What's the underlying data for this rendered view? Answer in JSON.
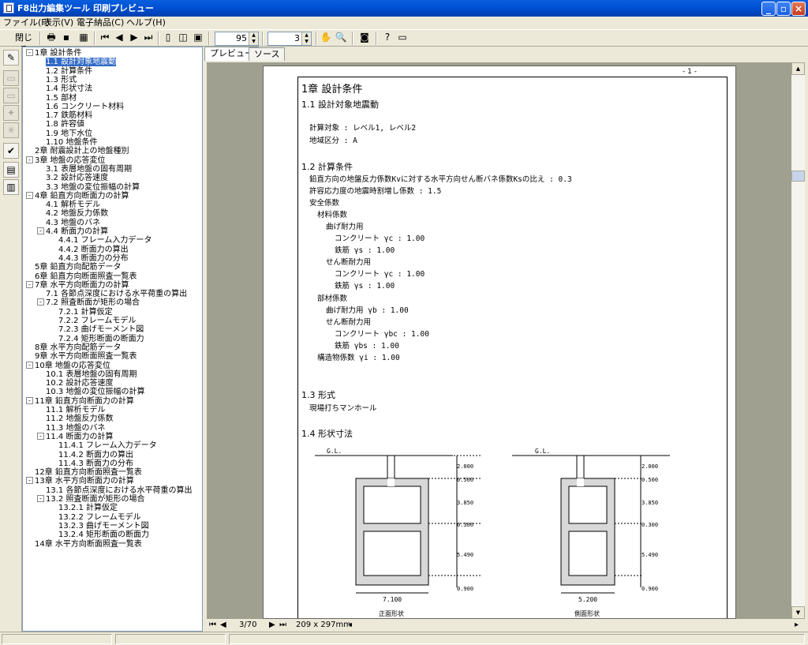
{
  "window": {
    "title": "F8出力編集ツール 印刷プレビュー"
  },
  "menu": [
    "ファイル(F)",
    "表示(V)",
    "電子納品(C)",
    "ヘルプ(H)"
  ],
  "toolbar": {
    "close_label": "閉じる",
    "zoom_value": "95",
    "page_value": "3"
  },
  "tabs": [
    "プレビュー",
    "ソース"
  ],
  "tree": [
    {
      "label": "1章 設計条件",
      "level": 0,
      "toggle": "-"
    },
    {
      "label": "1.1 設計対象地震動",
      "level": 1,
      "selected": true
    },
    {
      "label": "1.2 計算条件",
      "level": 1
    },
    {
      "label": "1.3 形式",
      "level": 1
    },
    {
      "label": "1.4 形状寸法",
      "level": 1
    },
    {
      "label": "1.5 部材",
      "level": 1
    },
    {
      "label": "1.6 コンクリート材料",
      "level": 1
    },
    {
      "label": "1.7 鉄筋材料",
      "level": 1
    },
    {
      "label": "1.8 許容値",
      "level": 1
    },
    {
      "label": "1.9 地下水位",
      "level": 1
    },
    {
      "label": "1.10 地盤条件",
      "level": 1
    },
    {
      "label": "2章 耐震設計上の地盤種別",
      "level": 0
    },
    {
      "label": "3章 地盤の応答変位",
      "level": 0,
      "toggle": "-"
    },
    {
      "label": "3.1 表層地盤の固有周期",
      "level": 1
    },
    {
      "label": "3.2 設計応答速度",
      "level": 1
    },
    {
      "label": "3.3 地盤の変位振幅の計算",
      "level": 1
    },
    {
      "label": "4章 鉛直方向断面力の計算",
      "level": 0,
      "toggle": "-"
    },
    {
      "label": "4.1 解析モデル",
      "level": 1
    },
    {
      "label": "4.2 地盤反力係数",
      "level": 1
    },
    {
      "label": "4.3 地盤のバネ",
      "level": 1
    },
    {
      "label": "4.4 断面力の計算",
      "level": 1,
      "toggle": "-"
    },
    {
      "label": "4.4.1 フレーム入力データ",
      "level": 2
    },
    {
      "label": "4.4.2 断面力の算出",
      "level": 2
    },
    {
      "label": "4.4.3 断面力の分布",
      "level": 2
    },
    {
      "label": "5章 鉛直方向配筋データ",
      "level": 0
    },
    {
      "label": "6章 鉛直方向断面照査一覧表",
      "level": 0
    },
    {
      "label": "7章 水平方向断面力の計算",
      "level": 0,
      "toggle": "-"
    },
    {
      "label": "7.1 各節点深度における水平荷重の算出",
      "level": 1
    },
    {
      "label": "7.2 照査断面が矩形の場合",
      "level": 1,
      "toggle": "-"
    },
    {
      "label": "7.2.1 計算仮定",
      "level": 2
    },
    {
      "label": "7.2.2 フレームモデル",
      "level": 2
    },
    {
      "label": "7.2.3 曲げモーメント図",
      "level": 2
    },
    {
      "label": "7.2.4 矩形断面の断面力",
      "level": 2
    },
    {
      "label": "8章 水平方向配筋データ",
      "level": 0
    },
    {
      "label": "9章 水平方向断面照査一覧表",
      "level": 0
    },
    {
      "label": "10章 地盤の応答変位",
      "level": 0,
      "toggle": "-"
    },
    {
      "label": "10.1 表層地盤の固有周期",
      "level": 1
    },
    {
      "label": "10.2 設計応答速度",
      "level": 1
    },
    {
      "label": "10.3 地盤の変位振幅の計算",
      "level": 1
    },
    {
      "label": "11章 鉛直方向断面力の計算",
      "level": 0,
      "toggle": "-"
    },
    {
      "label": "11.1 解析モデル",
      "level": 1
    },
    {
      "label": "11.2 地盤反力係数",
      "level": 1
    },
    {
      "label": "11.3 地盤のバネ",
      "level": 1
    },
    {
      "label": "11.4 断面力の計算",
      "level": 1,
      "toggle": "-"
    },
    {
      "label": "11.4.1 フレーム入力データ",
      "level": 2
    },
    {
      "label": "11.4.2 断面力の算出",
      "level": 2
    },
    {
      "label": "11.4.3 断面力の分布",
      "level": 2
    },
    {
      "label": "12章 鉛直方向断面照査一覧表",
      "level": 0
    },
    {
      "label": "13章 水平方向断面力の計算",
      "level": 0,
      "toggle": "-"
    },
    {
      "label": "13.1 各節点深度における水平荷重の算出",
      "level": 1
    },
    {
      "label": "13.2 照査断面が矩形の場合",
      "level": 1,
      "toggle": "-"
    },
    {
      "label": "13.2.1 計算仮定",
      "level": 2
    },
    {
      "label": "13.2.2 フレームモデル",
      "level": 2
    },
    {
      "label": "13.2.3 曲げモーメント図",
      "level": 2
    },
    {
      "label": "13.2.4 矩形断面の断面力",
      "level": 2
    },
    {
      "label": "14章 水平方向断面照査一覧表",
      "level": 0
    }
  ],
  "page": {
    "page_number": "- 1 -",
    "chapter_title": "1章 設計条件",
    "s11": "1.1 設計対象地震動",
    "calc_target": "計算対象 : レベル1, レベル2",
    "region": "地域区分 : A",
    "s12": "1.2 計算条件",
    "ratio": "鉛直方向の地盤反力係数Kvに対する水平方向せん断バネ係数Ksの比え : 0.3",
    "allow": "許容応力度の地震時割増し係数 : 1.5",
    "safety": "安全係数",
    "material": "材料係数",
    "bend1": "曲げ耐力用",
    "conc1": "コンクリート γc : 1.00",
    "steel1": "鉄筋 γs : 1.00",
    "shear1": "せん断耐力用",
    "conc2": "コンクリート γc : 1.00",
    "steel2": "鉄筋 γs : 1.00",
    "member": "部材係数",
    "bend2": "曲げ耐力用 γb : 1.00",
    "shear2": "せん断耐力用",
    "conc3": "コンクリート γbc : 1.00",
    "steel3": "鉄筋 γbs : 1.00",
    "struct": "構造物係数 γi : 1.00",
    "s13": "1.3 形式",
    "form": "現場打ちマンホール",
    "s14": "1.4 形状寸法",
    "gl": "G.L.",
    "dims": [
      "2.000",
      "0.500",
      "3.850",
      "0.300",
      "5.490",
      "0.900"
    ],
    "front_width": "7.100",
    "side_width": "5.200",
    "front_label": "正面形状",
    "side_label": "側面形状"
  },
  "nav": {
    "page": "3/70",
    "size": "209 x 297mm"
  }
}
